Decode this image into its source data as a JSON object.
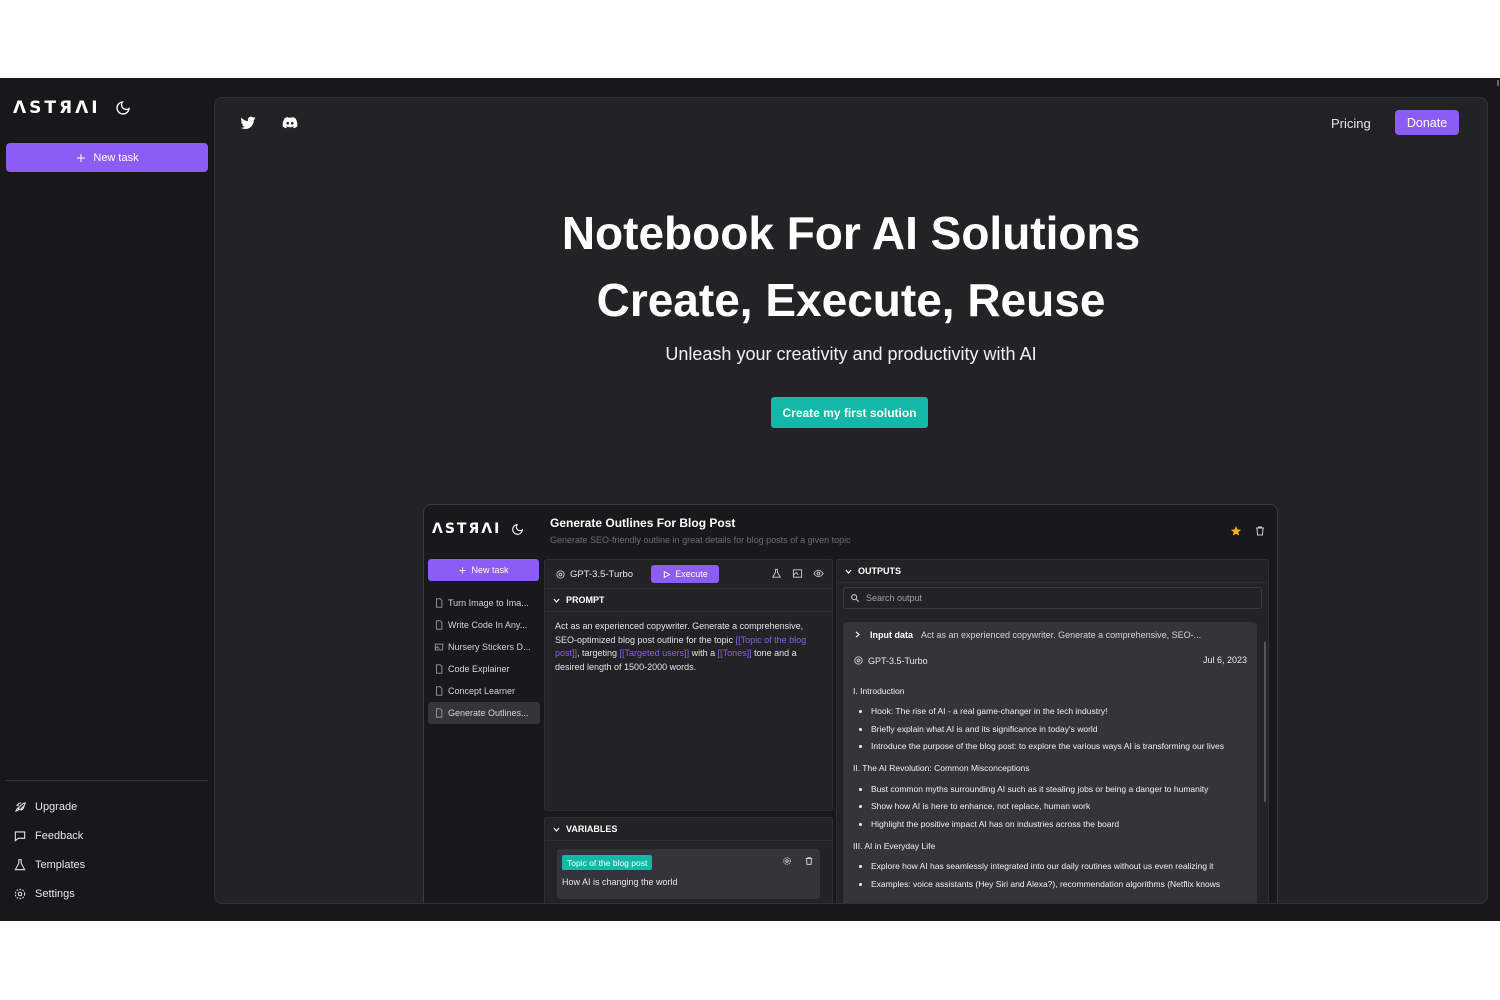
{
  "sidebar": {
    "logo": "ΛSTЯΛI",
    "new_task": "New task",
    "menu": [
      "Upgrade",
      "Feedback",
      "Templates",
      "Settings"
    ]
  },
  "header": {
    "pricing": "Pricing",
    "donate": "Donate"
  },
  "hero": {
    "title_line1": "Notebook For AI Solutions",
    "title_line2": "Create, Execute, Reuse",
    "subtitle": "Unleash your creativity and productivity with AI",
    "cta": "Create my first solution"
  },
  "preview": {
    "logo": "ΛSTЯΛI",
    "title": "Generate Outlines For Blog Post",
    "description": "Generate SEO-friendly outline in great details for blog posts of a given topic",
    "new_task": "New task",
    "tasks": [
      "Turn Image to Ima...",
      "Write Code In Any...",
      "Nursery Stickers D...",
      "Code Explainer",
      "Concept Learner",
      "Generate Outlines..."
    ],
    "model": "GPT-3.5-Turbo",
    "execute": "Execute",
    "prompt_heading": "PROMPT",
    "prompt": {
      "p1": "Act as an experienced copywriter. Generate a comprehensive, SEO-optimized blog post outline for the topic ",
      "v1": "[[Topic of the blog post]]",
      "p2": ", targeting ",
      "v2": "[[Targeted users]]",
      "p3": " with a ",
      "v3": "[[Tones]]",
      "p4": " tone and a desired length of 1500-2000 words."
    },
    "variables_heading": "VARIABLES",
    "variable_tag": "Topic of the blog post",
    "variable_value": "How AI is changing the world",
    "outputs_heading": "OUTPUTS",
    "search_placeholder": "Search output",
    "input_data_label": "Input data",
    "input_data_value": "Act as an experienced copywriter. Generate a comprehensive, SEO-...",
    "output_model": "GPT-3.5-Turbo",
    "output_date": "Jul 6, 2023",
    "outline": [
      {
        "heading": "I. Introduction",
        "items": [
          "Hook: The rise of AI - a real game-changer in the tech industry!",
          "Briefly explain what AI is and its significance in today's world",
          "Introduce the purpose of the blog post: to explore the various ways AI is transforming our lives"
        ]
      },
      {
        "heading": "II. The AI Revolution: Common Misconceptions",
        "items": [
          "Bust common myths surrounding AI such as it stealing jobs or being a danger to humanity",
          "Show how AI is here to enhance, not replace, human work",
          "Highlight the positive impact AI has on industries across the board"
        ]
      },
      {
        "heading": "III. AI in Everyday Life",
        "items": [
          "Explore how AI has seamlessly integrated into our daily routines without us even realizing it",
          "Examples: voice assistants (Hey Siri and Alexa?), recommendation algorithms (Netflix knows"
        ]
      }
    ]
  },
  "colors": {
    "accent": "#8b5cf6",
    "cta": "#14b8a6",
    "background": "#18181b",
    "panel": "#232326"
  }
}
